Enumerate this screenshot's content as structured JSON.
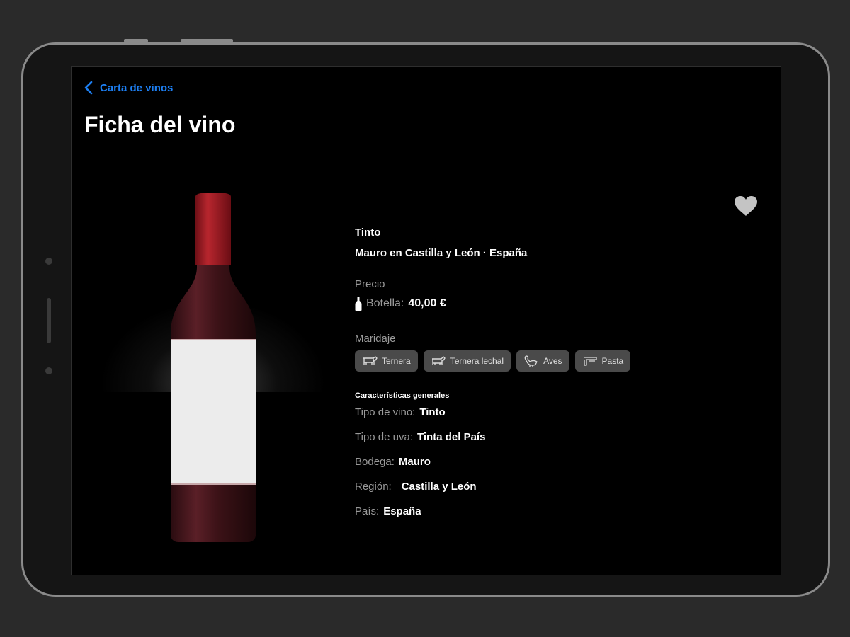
{
  "nav": {
    "back_label": "Carta de vinos"
  },
  "page": {
    "title": "Ficha del vino"
  },
  "wine": {
    "type": "Tinto",
    "origin": "Mauro en Castilla y León · España"
  },
  "price": {
    "label": "Precio",
    "bottle_label": "Botella:",
    "bottle_value": "40,00 €"
  },
  "pairing": {
    "label": "Maridaje",
    "items": [
      {
        "label": "Ternera",
        "icon": "cow-icon"
      },
      {
        "label": "Ternera lechal",
        "icon": "calf-icon"
      },
      {
        "label": "Aves",
        "icon": "bird-icon"
      },
      {
        "label": "Pasta",
        "icon": "pasta-icon"
      }
    ]
  },
  "characteristics": {
    "title": "Características generales",
    "rows": [
      {
        "key": "Tipo de vino:",
        "value": "Tinto"
      },
      {
        "key": "Tipo de uva:",
        "value": "Tinta del País"
      },
      {
        "key": "Bodega:",
        "value": "Mauro"
      },
      {
        "key": "Región:",
        "value": "Castilla y León"
      },
      {
        "key": "País:",
        "value": "España"
      }
    ]
  },
  "icons": {
    "back": "chevron-left-icon",
    "favorite": "heart-icon",
    "bottle": "wine-bottle-icon"
  },
  "colors": {
    "accent": "#1d7ff2",
    "background": "#000000",
    "chip": "#4a4a4a",
    "capsule": "#a51d24"
  }
}
